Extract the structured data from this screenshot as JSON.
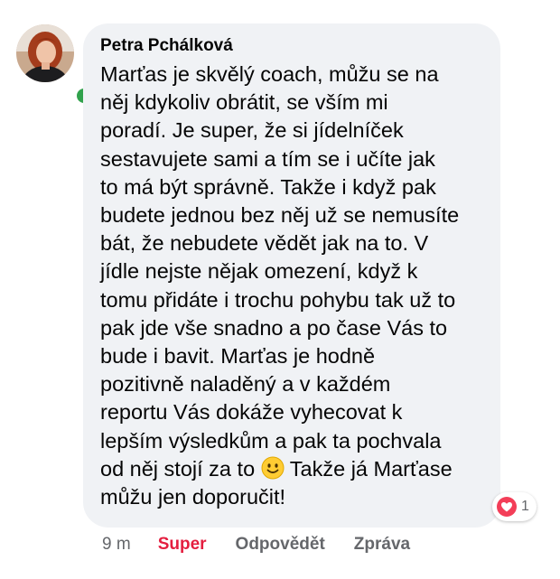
{
  "comment": {
    "author": "Petra Pchálková",
    "online": true,
    "text_before_emoji": "Marťas je skvělý coach, můžu se na\nněj kdykoliv obrátit, se vším mi\nporadí. Je super, že si jídelníček\nsestavujete sami a tím se i učíte jak\nto má být správně. Takže i když pak\nbudete jednou bez něj už se nemusíte\nbát, že nebudete vědět jak na to. V\njídle nejste nějak omezení, když k\ntomu přidáte i trochu pohybu tak už to\npak jde vše snadno a po čase Vás to\nbude i bavit. Marťas je hodně\npozitivně naladěný a v každém\nreportu Vás dokáže vyhecovat k\nlepším výsledkům a pak ta pochvala\nod něj stojí za to",
    "text_after_emoji": " Takže já Marťase\nmůžu jen doporučit!",
    "emoji": "slightly-smiling-face",
    "reaction": {
      "type": "love",
      "count": "1"
    },
    "actions": {
      "time": "9 m",
      "like_label": "Super",
      "reply_label": "Odpovědět",
      "message_label": "Zpráva"
    }
  },
  "colors": {
    "bubble": "#f0f2f5",
    "online": "#31a24c",
    "like_active": "#e41e3f",
    "secondary_text": "#65676b",
    "love_reaction": "#f33e58"
  }
}
